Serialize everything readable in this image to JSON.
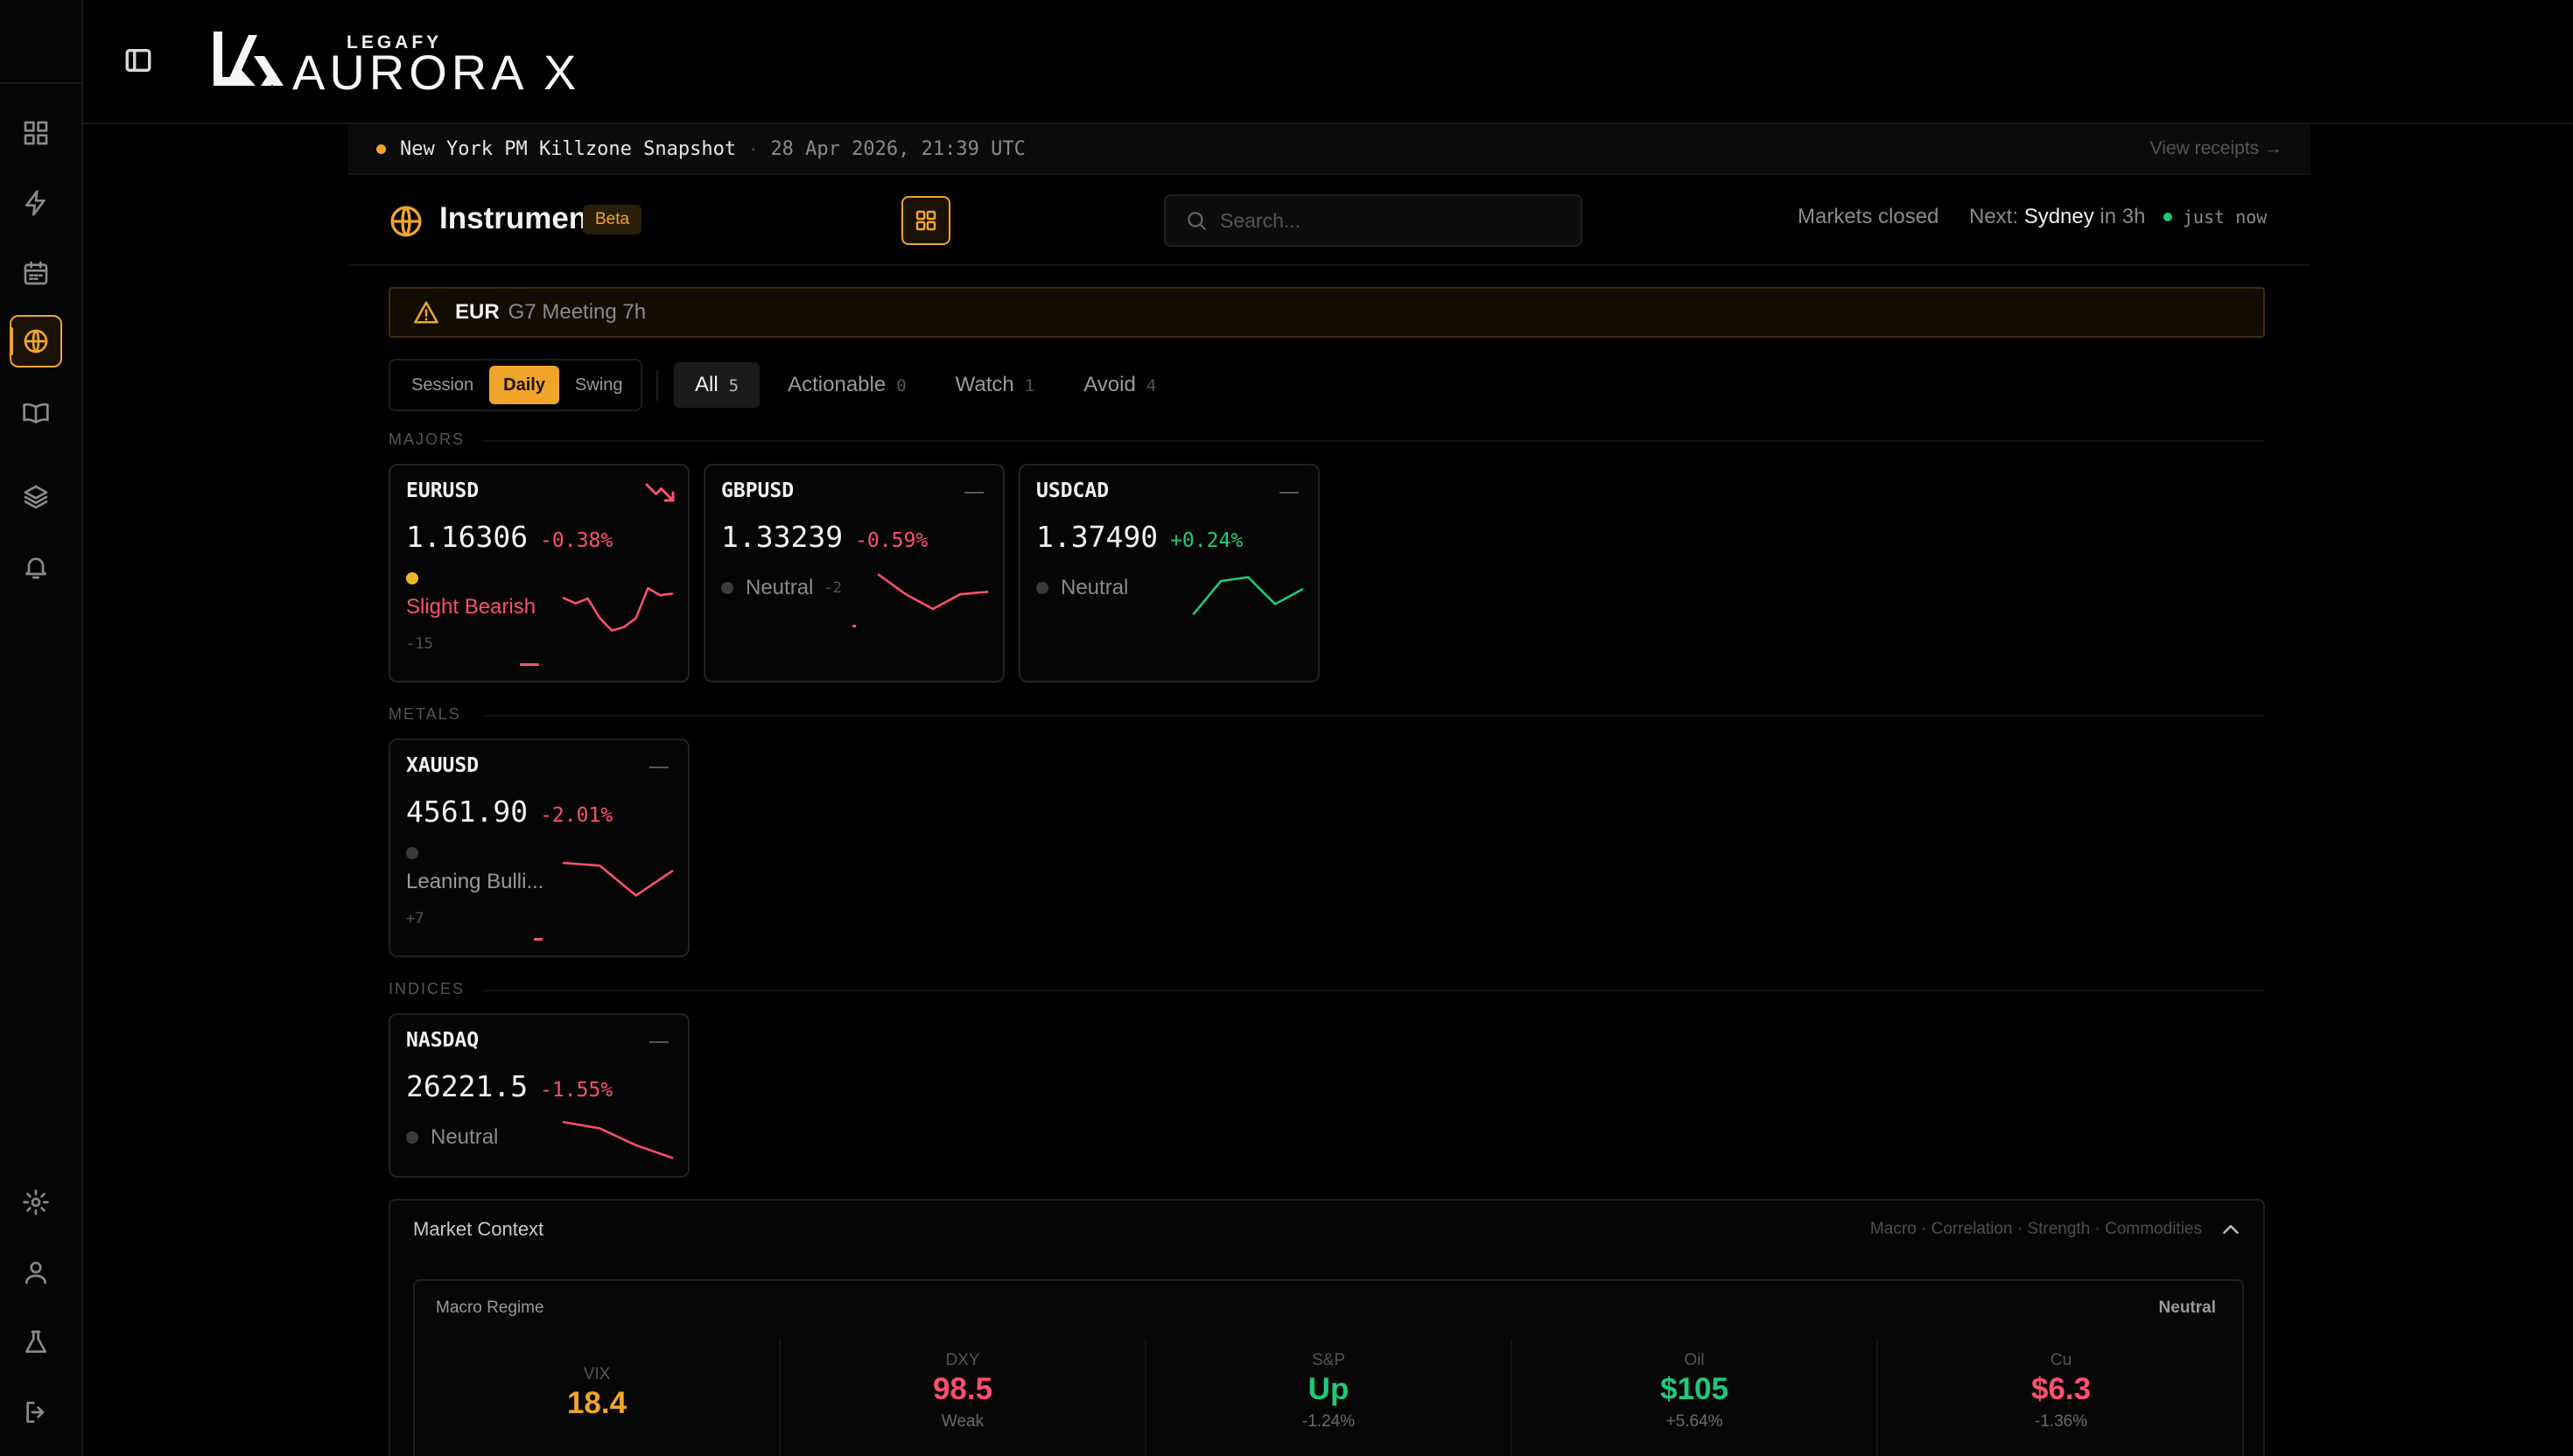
{
  "app": {
    "brand_small": "LEGAFY",
    "brand_big": "AURORA X"
  },
  "sidebar": {
    "items": [
      {
        "icon": "dashboard-icon"
      },
      {
        "icon": "lightning-icon"
      },
      {
        "icon": "calendar-icon"
      },
      {
        "icon": "globe-icon",
        "active": true
      },
      {
        "icon": "book-icon"
      },
      {
        "icon": "layers-icon"
      },
      {
        "icon": "bell-icon"
      },
      {
        "icon": "settings-icon"
      },
      {
        "icon": "user-icon"
      },
      {
        "icon": "flask-icon"
      },
      {
        "icon": "logout-icon"
      }
    ]
  },
  "snapshot": {
    "title": "New York PM Killzone Snapshot",
    "separator": "·",
    "timestamp": "28 Apr 2026, 21:39 UTC",
    "link": "View receipts →"
  },
  "header": {
    "title": "Instruments",
    "badge": "Beta",
    "search_placeholder": "Search...",
    "market_status": "Markets closed",
    "next_label": "Next:",
    "next_city": "Sydney",
    "next_eta": "in 3h",
    "updated": "just now"
  },
  "alert": {
    "currency": "EUR",
    "text": "G7 Meeting 7h"
  },
  "timeframes": [
    "Session",
    "Daily",
    "Swing"
  ],
  "active_timeframe": "Daily",
  "filters": [
    {
      "label": "All",
      "count": "5"
    },
    {
      "label": "Actionable",
      "count": "0"
    },
    {
      "label": "Watch",
      "count": "1"
    },
    {
      "label": "Avoid",
      "count": "4"
    }
  ],
  "groups": {
    "majors": "MAJORS",
    "metals": "METALS",
    "indices": "INDICES"
  },
  "cards": {
    "eurusd": {
      "symbol": "EURUSD",
      "price": "1.16306",
      "change": "-0.38%",
      "bias": "Slight Bearish",
      "score": "-15",
      "spark": [
        0.72,
        0.62,
        0.71,
        0.35,
        0.12,
        0.18,
        0.35,
        0.9,
        0.77,
        0.8
      ]
    },
    "gbpusd": {
      "symbol": "GBPUSD",
      "price": "1.33239",
      "change": "-0.59%",
      "bias": "Neutral",
      "score": "-2",
      "spark": [
        0.95,
        0.55,
        0.25,
        0.55,
        0.6
      ]
    },
    "usdcad": {
      "symbol": "USDCAD",
      "price": "1.37490",
      "change": "+0.24%",
      "bias": "Neutral",
      "spark": [
        0.15,
        0.82,
        0.9,
        0.35,
        0.65
      ]
    },
    "xauusd": {
      "symbol": "XAUUSD",
      "price": "4561.90",
      "change": "-2.01%",
      "bias": "Leaning Bulli...",
      "score": "+7",
      "spark": [
        0.9,
        0.85,
        0.3,
        0.75
      ]
    },
    "nasdaq": {
      "symbol": "NASDAQ",
      "price": "26221.5",
      "change": "-1.55%",
      "bias": "Neutral",
      "spark": [
        0.95,
        0.8,
        0.4,
        0.1
      ]
    }
  },
  "context": {
    "title": "Market Context",
    "tabs": "Macro · Correlation · Strength · Commodities",
    "macro_title": "Macro Regime",
    "regime": "Neutral",
    "metrics": [
      {
        "label": "VIX",
        "value": "18.4",
        "sub": "",
        "color": "#f0a52a"
      },
      {
        "label": "DXY",
        "value": "98.5",
        "sub": "Weak",
        "color": "#ff4f6d"
      },
      {
        "label": "S&P",
        "value": "Up",
        "sub": "-1.24%",
        "color": "#20c97a"
      },
      {
        "label": "Oil",
        "value": "$105",
        "sub": "+5.64%",
        "color": "#20c97a"
      },
      {
        "label": "Cu",
        "value": "$6.3",
        "sub": "-1.36%",
        "color": "#ff4f6d"
      }
    ]
  },
  "colors": {
    "accent": "#f0a52a",
    "negative": "#ff4f6d",
    "positive": "#20c97a"
  }
}
